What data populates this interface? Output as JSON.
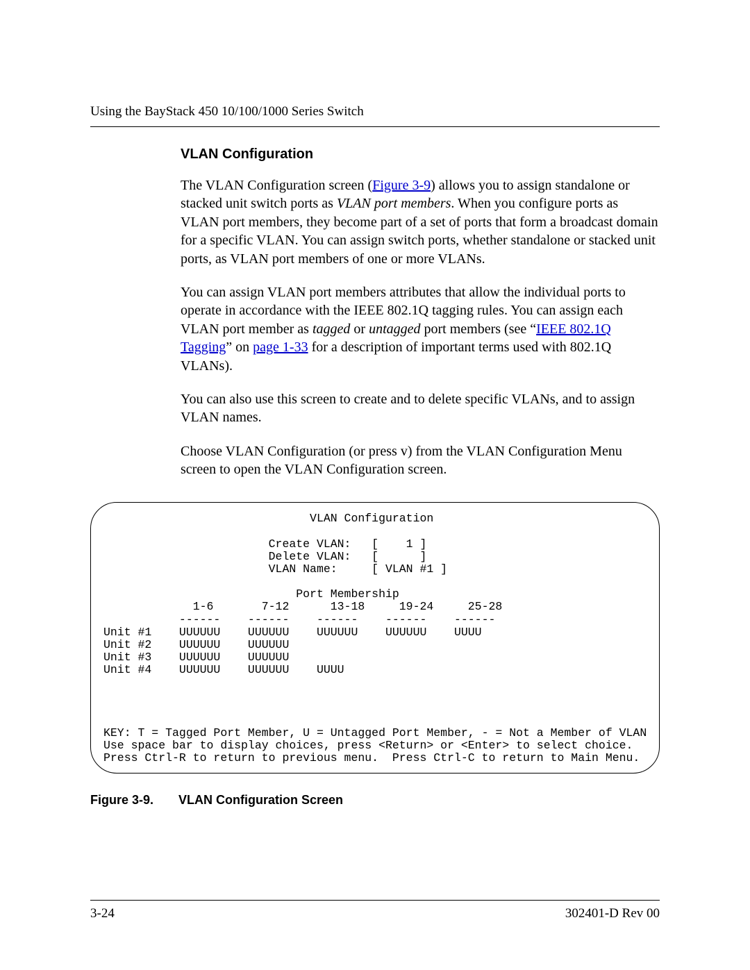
{
  "header": {
    "running": "Using the BayStack 450 10/100/1000 Series Switch"
  },
  "section": {
    "heading": "VLAN Configuration"
  },
  "para1": {
    "a": "The VLAN Configuration screen (",
    "link": "Figure 3-9",
    "b": ") allows you to assign standalone or stacked unit switch ports as ",
    "ital": "VLAN port members",
    "c": ". When you configure ports as VLAN port members, they become part of a set of ports that form a broadcast domain for a specific VLAN. You can assign switch ports, whether standalone or stacked unit ports, as VLAN port members of one or more VLANs."
  },
  "para2": {
    "a": "You can assign VLAN port members attributes that allow the individual ports to operate in accordance with the IEEE 802.1Q tagging rules. You can assign each VLAN port member as ",
    "tag": "tagged",
    "b": " or ",
    "untag": "untagged",
    "c": " port members (see “",
    "link1a": "IEEE 802.1Q",
    "link1b": "Tagging",
    "d": "” on ",
    "link2": "page 1-33",
    "e": " for a description of important terms used with 802.1Q VLANs)."
  },
  "para3": "You can also use this screen to create and to delete specific VLANs, and to assign VLAN names.",
  "para4": "Choose VLAN Configuration (or press v) from the VLAN Configuration Menu screen to open the VLAN Configuration screen.",
  "terminal": {
    "title": "                              VLAN Configuration",
    "create": "                        Create VLAN:   [    1 ]",
    "delete": "                        Delete VLAN:   [      ]",
    "name": "                        VLAN Name:     [ VLAN #1 ]",
    "pm": "                            Port Membership",
    "cols": "             1-6       7-12      13-18     19-24     25-28",
    "dash": "           ------    ------    ------    ------    ------",
    "u1": "Unit #1    UUUUUU    UUUUUU    UUUUUU    UUUUUU    UUUU",
    "u2": "Unit #2    UUUUUU    UUUUUU",
    "u3": "Unit #3    UUUUUU    UUUUUU",
    "u4": "Unit #4    UUUUUU    UUUUUU    UUUU",
    "key": "KEY: T = Tagged Port Member, U = Untagged Port Member, - = Not a Member of VLAN",
    "hint": "Use space bar to display choices, press <Return> or <Enter> to select choice.",
    "nav": "Press Ctrl-R to return to previous menu.  Press Ctrl-C to return to Main Menu."
  },
  "caption": {
    "label": "Figure 3-9.",
    "text": "VLAN Configuration Screen"
  },
  "footer": {
    "page": "3-24",
    "doc": "302401-D Rev 00"
  }
}
